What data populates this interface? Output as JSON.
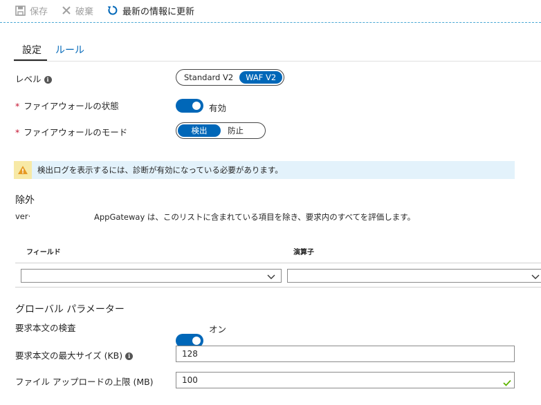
{
  "toolbar": {
    "save_label": "保存",
    "discard_label": "破棄",
    "refresh_label": "最新の情報に更新"
  },
  "tabs": [
    {
      "label": "設定",
      "active": true
    },
    {
      "label": "ルール",
      "active": false
    }
  ],
  "form": {
    "tier": {
      "label": "レベル",
      "options": [
        "Standard V2",
        "WAF V2"
      ],
      "selected": "WAF V2"
    },
    "firewall_status": {
      "required_mark": "*",
      "label": "ファイアウォールの状態",
      "value": "有効",
      "on": true
    },
    "firewall_mode": {
      "required_mark": "*",
      "label": "ファイアウォールのモード",
      "options": [
        "検出",
        "防止"
      ],
      "selected": "検出"
    }
  },
  "banner": {
    "text": "検出ログを表示するには、診断が有効になっている必要があります。"
  },
  "exclusions": {
    "title": "除外",
    "description_prefix": "ver·",
    "description": "AppGateway は、このリストに含まれている項目を除き、要求内のすべてを評価します。",
    "columns": [
      "フィールド",
      "演算子"
    ]
  },
  "global_params": {
    "title": "グローバル パラメーター",
    "body_inspection": {
      "label": "要求本文の検査",
      "value": "オン",
      "on": true
    },
    "max_body_size": {
      "label": "要求本文の最大サイズ (KB)",
      "value": "128"
    },
    "file_upload_limit": {
      "label": "ファイル アップロードの上限 (MB)",
      "value": "100"
    }
  },
  "colors": {
    "accent": "#0067b8",
    "required": "#c4122f",
    "banner_bg": "#e3f2fb",
    "valid_check": "#5db300"
  }
}
